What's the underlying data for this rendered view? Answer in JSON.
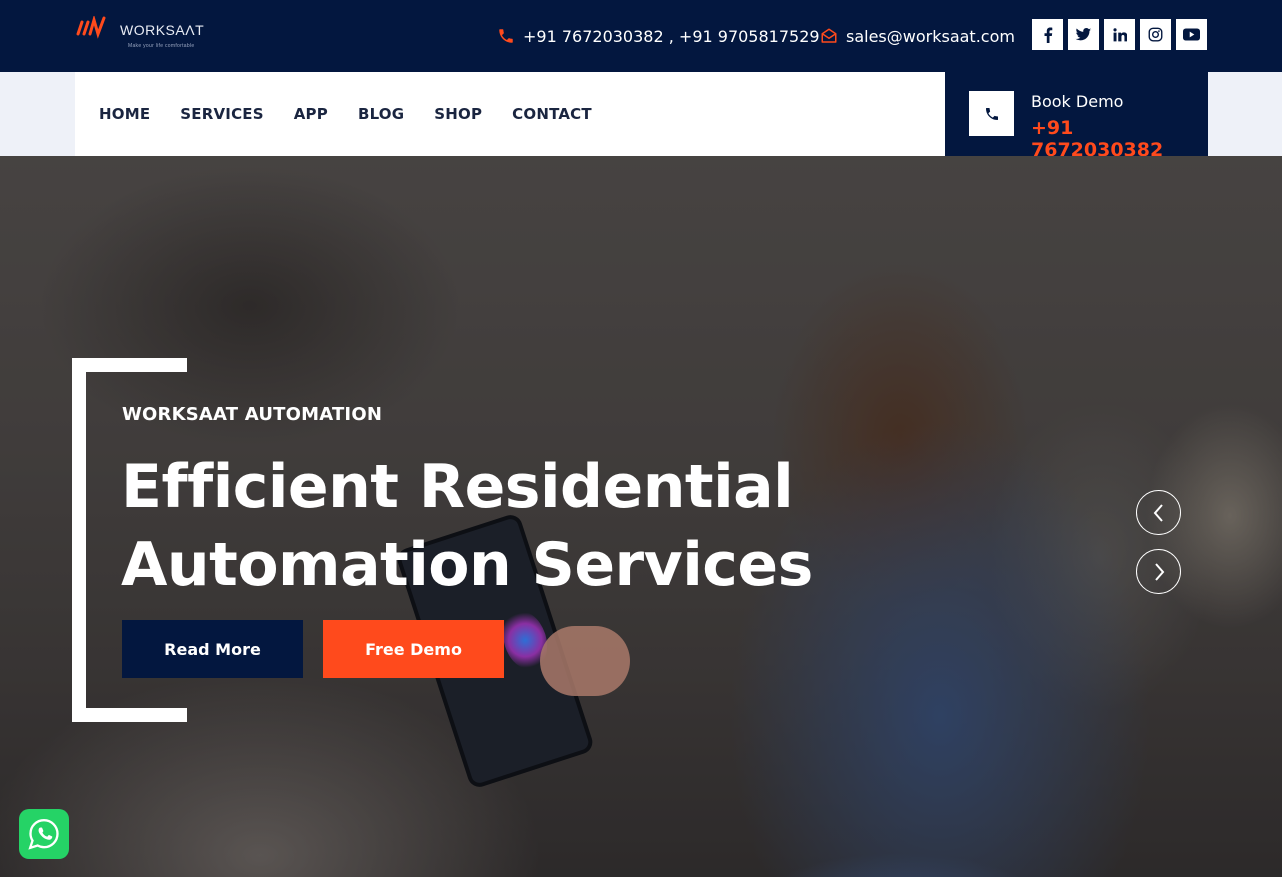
{
  "brand": {
    "name": "WORKSAɅT",
    "tagline": "Make your life comfortable",
    "accent": "#ff4a1c",
    "navy": "#03173f"
  },
  "topbar": {
    "phones": "+91 7672030382 , +91 9705817529",
    "email": "sales@worksaat.com",
    "social": [
      {
        "icon": "facebook-icon",
        "glyph": "f"
      },
      {
        "icon": "twitter-icon",
        "glyph": "t"
      },
      {
        "icon": "linkedin-icon",
        "glyph": "in"
      },
      {
        "icon": "instagram-icon",
        "glyph": "ig"
      },
      {
        "icon": "youtube-icon",
        "glyph": "yt"
      }
    ]
  },
  "nav": {
    "items": [
      "HOME",
      "SERVICES",
      "APP",
      "BLOG",
      "SHOP",
      "CONTACT"
    ]
  },
  "book_demo": {
    "label": "Book Demo",
    "phone": "+91 7672030382"
  },
  "hero": {
    "subtitle": "WORKSAAT AUTOMATION",
    "title_line1": "Efficient Residential",
    "title_line2": "Automation Services",
    "read_more": "Read More",
    "free_demo": "Free Demo"
  }
}
